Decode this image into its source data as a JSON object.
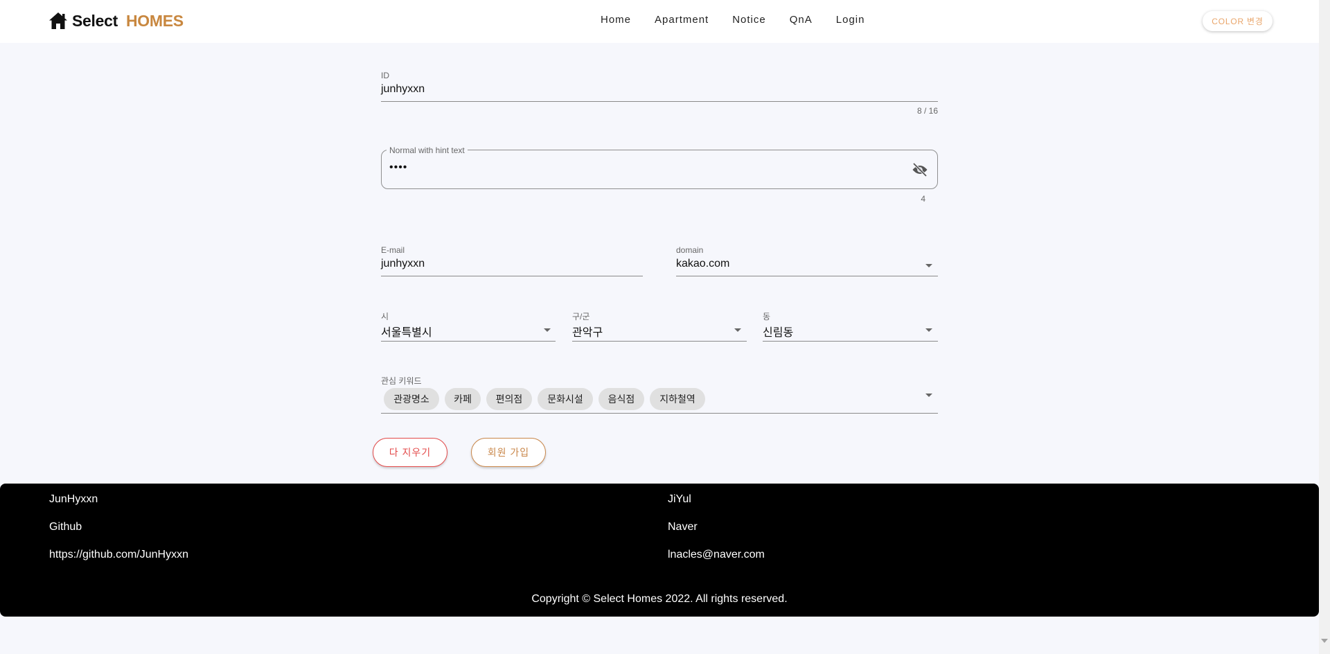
{
  "header": {
    "logo_text": "Select",
    "logo_accent": "HOMES",
    "nav": [
      "Home",
      "Apartment",
      "Notice",
      "QnA",
      "Login"
    ],
    "color_button": "COLOR 변경"
  },
  "form": {
    "id": {
      "label": "ID",
      "value": "junhyxxn",
      "counter": "8 / 16"
    },
    "password": {
      "label": "Normal with hint text",
      "value": "••••",
      "counter": "4"
    },
    "email": {
      "label": "E-mail",
      "value": "junhyxxn"
    },
    "domain": {
      "label": "domain",
      "value": "kakao.com"
    },
    "city": {
      "label": "시",
      "value": "서울특별시"
    },
    "district": {
      "label": "구/군",
      "value": "관악구"
    },
    "dong": {
      "label": "동",
      "value": "신림동"
    },
    "keywords": {
      "label": "관심 키워드",
      "chips": [
        "관광명소",
        "카페",
        "편의점",
        "문화시설",
        "음식점",
        "지하철역"
      ]
    },
    "buttons": {
      "clear": "다 지우기",
      "join": "회원 가입"
    }
  },
  "footer": {
    "left": {
      "name": "JunHyxxn",
      "service": "Github",
      "link": "https://github.com/JunHyxxn"
    },
    "right": {
      "name": "JiYul",
      "service": "Naver",
      "link": "lnacles@naver.com"
    },
    "copyright": "Copyright © Select Homes 2022. All rights reserved."
  },
  "colors": {
    "accent": "#c8873f",
    "danger": "#e34a4a",
    "background": "#f6f7fc",
    "footer": "#000000"
  }
}
